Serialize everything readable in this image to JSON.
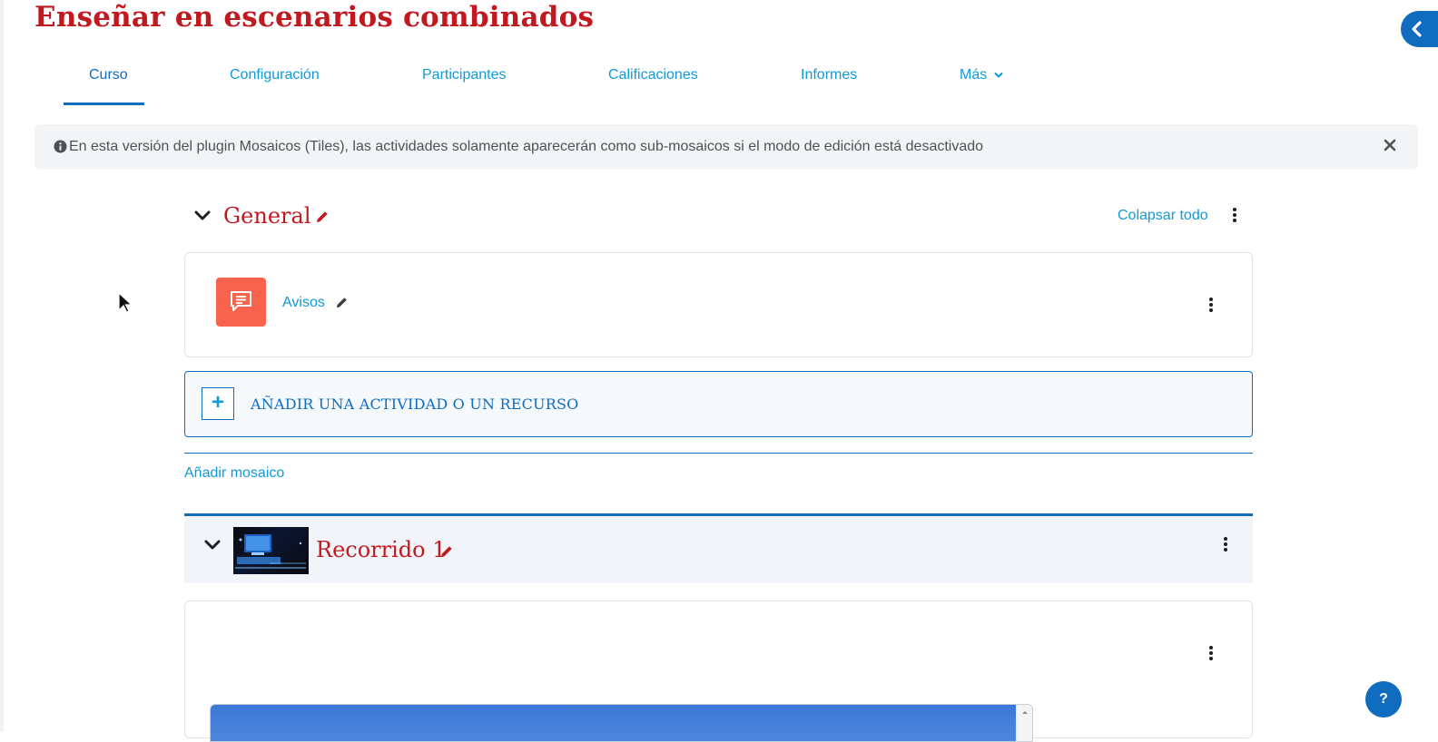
{
  "page": {
    "title": "Enseñar en escenarios combinados"
  },
  "nav": {
    "tabs": [
      {
        "label": "Curso",
        "active": true
      },
      {
        "label": "Configuración",
        "active": false
      },
      {
        "label": "Participantes",
        "active": false
      },
      {
        "label": "Calificaciones",
        "active": false
      },
      {
        "label": "Informes",
        "active": false
      },
      {
        "label": "Más",
        "active": false
      }
    ]
  },
  "alert": {
    "icon": "info-circle-icon",
    "text": "En esta versión del plugin Mosaicos (Tiles), las actividades solamente aparecerán como sub-mosaicos si el modo de edición está desactivado",
    "close_icon": "close-icon"
  },
  "section_general": {
    "title": "General",
    "collapse_all": "Colapsar todo",
    "activity": {
      "name": "Avisos",
      "icon": "forum-icon"
    },
    "add_activity_label": "AÑADIR UNA ACTIVIDAD O UN RECURSO",
    "add_tile_label": "Añadir mosaico"
  },
  "section_recorrido": {
    "title": "Recorrido 1"
  },
  "help": {
    "label": "?"
  },
  "colors": {
    "title_red": "#c0191f",
    "primary_blue": "#0f6cbf",
    "link_blue": "#0f9ad8",
    "forum_orange": "#f7634d"
  }
}
